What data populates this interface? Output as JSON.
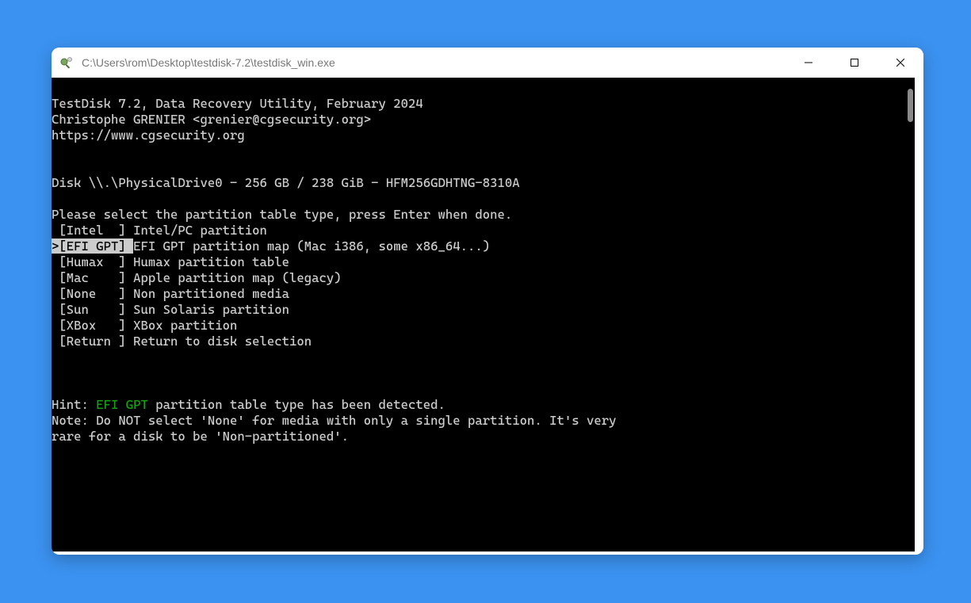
{
  "window": {
    "title": "C:\\Users\\rom\\Desktop\\testdisk-7.2\\testdisk_win.exe"
  },
  "term": {
    "header1": "TestDisk 7.2, Data Recovery Utility, February 2024",
    "header2": "Christophe GRENIER <grenier@cgsecurity.org>",
    "header3": "https://www.cgsecurity.org",
    "diskline": "Disk \\\\.\\PhysicalDrive0 - 256 GB / 238 GiB - HFM256GDHTNG-8310A",
    "prompt": "Please select the partition table type, press Enter when done.",
    "options": [
      {
        "label": " [Intel  ] ",
        "desc": "Intel/PC partition",
        "selected": false
      },
      {
        "label": ">[EFI GPT] ",
        "desc": "EFI GPT partition map (Mac i386, some x86_64...)",
        "selected": true
      },
      {
        "label": " [Humax  ] ",
        "desc": "Humax partition table",
        "selected": false
      },
      {
        "label": " [Mac    ] ",
        "desc": "Apple partition map (legacy)",
        "selected": false
      },
      {
        "label": " [None   ] ",
        "desc": "Non partitioned media",
        "selected": false
      },
      {
        "label": " [Sun    ] ",
        "desc": "Sun Solaris partition",
        "selected": false
      },
      {
        "label": " [XBox   ] ",
        "desc": "XBox partition",
        "selected": false
      },
      {
        "label": " [Return ] ",
        "desc": "Return to disk selection",
        "selected": false
      }
    ],
    "hint_prefix": "Hint: ",
    "hint_detected": "EFI GPT",
    "hint_suffix": " partition table type has been detected.",
    "note1": "Note: Do NOT select 'None' for media with only a single partition. It's very",
    "note2": "rare for a disk to be 'Non-partitioned'."
  }
}
